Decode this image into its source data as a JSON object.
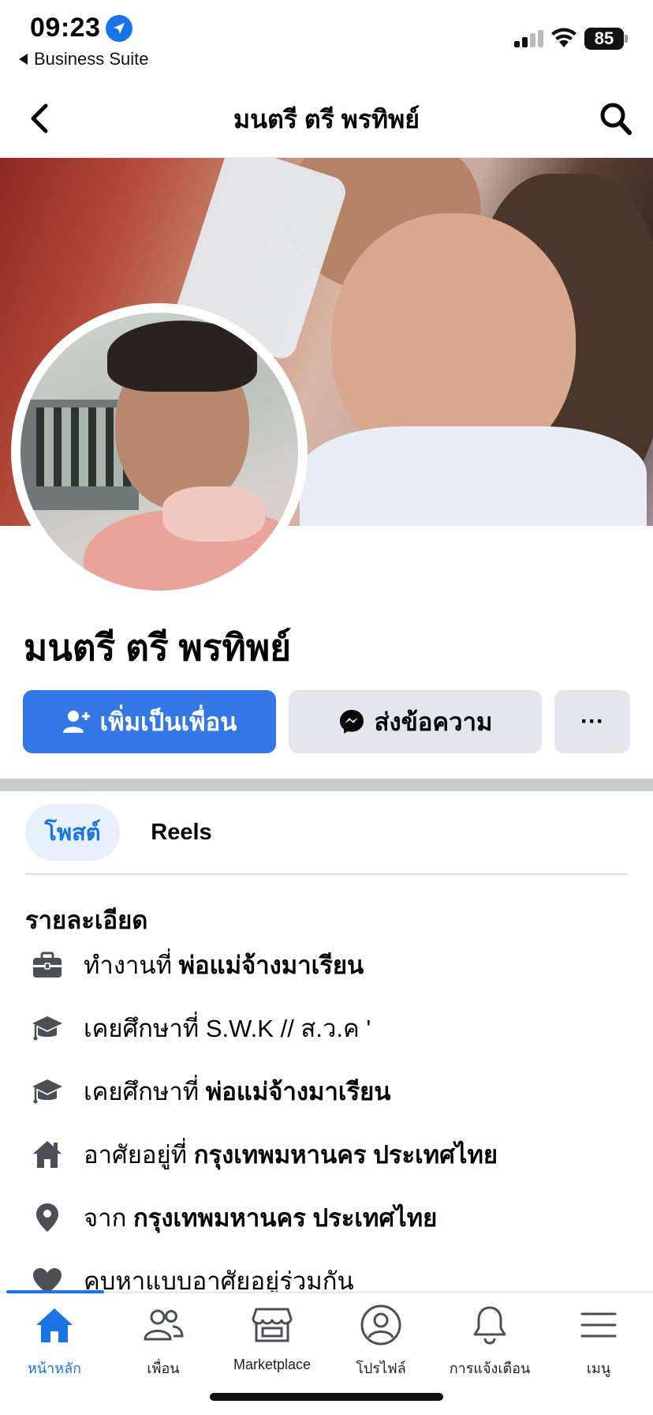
{
  "status_bar": {
    "time": "09:23",
    "back_app": "Business Suite",
    "battery": "85"
  },
  "nav": {
    "title": "มนตรี ตรี พรทิพย์"
  },
  "profile": {
    "name": "มนตรี ตรี พรทิพย์",
    "add_friend_label": "เพิ่มเป็นเพื่อน",
    "message_label": "ส่งข้อความ",
    "more_label": "···"
  },
  "tabs": [
    {
      "label": "โพสต์",
      "active": true
    },
    {
      "label": "Reels",
      "active": false
    }
  ],
  "details": {
    "title": "รายละเอียด",
    "items": [
      {
        "icon": "briefcase-icon",
        "prefix": "ทำงานที่ ",
        "value": "พ่อแม่จ้างมาเรียน",
        "value_bold": true
      },
      {
        "icon": "graduation-cap-icon",
        "prefix": "เคยศึกษาที่ ",
        "value": "S.W.K // ส.ว.ค '",
        "value_bold": false
      },
      {
        "icon": "graduation-cap-icon",
        "prefix": "เคยศึกษาที่ ",
        "value": "พ่อแม่จ้างมาเรียน",
        "value_bold": true
      },
      {
        "icon": "home-icon",
        "prefix": "อาศัยอยู่ที่ ",
        "value": "กรุงเทพมหานคร ประเทศไทย",
        "value_bold": true
      },
      {
        "icon": "location-pin-icon",
        "prefix": "จาก ",
        "value": "กรุงเทพมหานคร ประเทศไทย",
        "value_bold": true
      },
      {
        "icon": "heart-icon",
        "prefix": "คบหาแบบอาศัยอยู่ร่วมกัน",
        "value": "",
        "value_bold": false
      }
    ]
  },
  "bottom_nav": [
    {
      "label": "หน้าหลัก",
      "icon": "home-icon",
      "active": true
    },
    {
      "label": "เพื่อน",
      "icon": "friends-icon",
      "active": false
    },
    {
      "label": "Marketplace",
      "icon": "marketplace-icon",
      "active": false
    },
    {
      "label": "โปรไฟล์",
      "icon": "profile-icon",
      "active": false
    },
    {
      "label": "การแจ้งเตือน",
      "icon": "bell-icon",
      "active": false
    },
    {
      "label": "เมนู",
      "icon": "menu-icon",
      "active": false
    }
  ],
  "colors": {
    "accent": "#1b74e4",
    "button_primary": "#3578e5",
    "button_secondary": "#e4e6eb",
    "icon_gray": "#4b4f56"
  }
}
